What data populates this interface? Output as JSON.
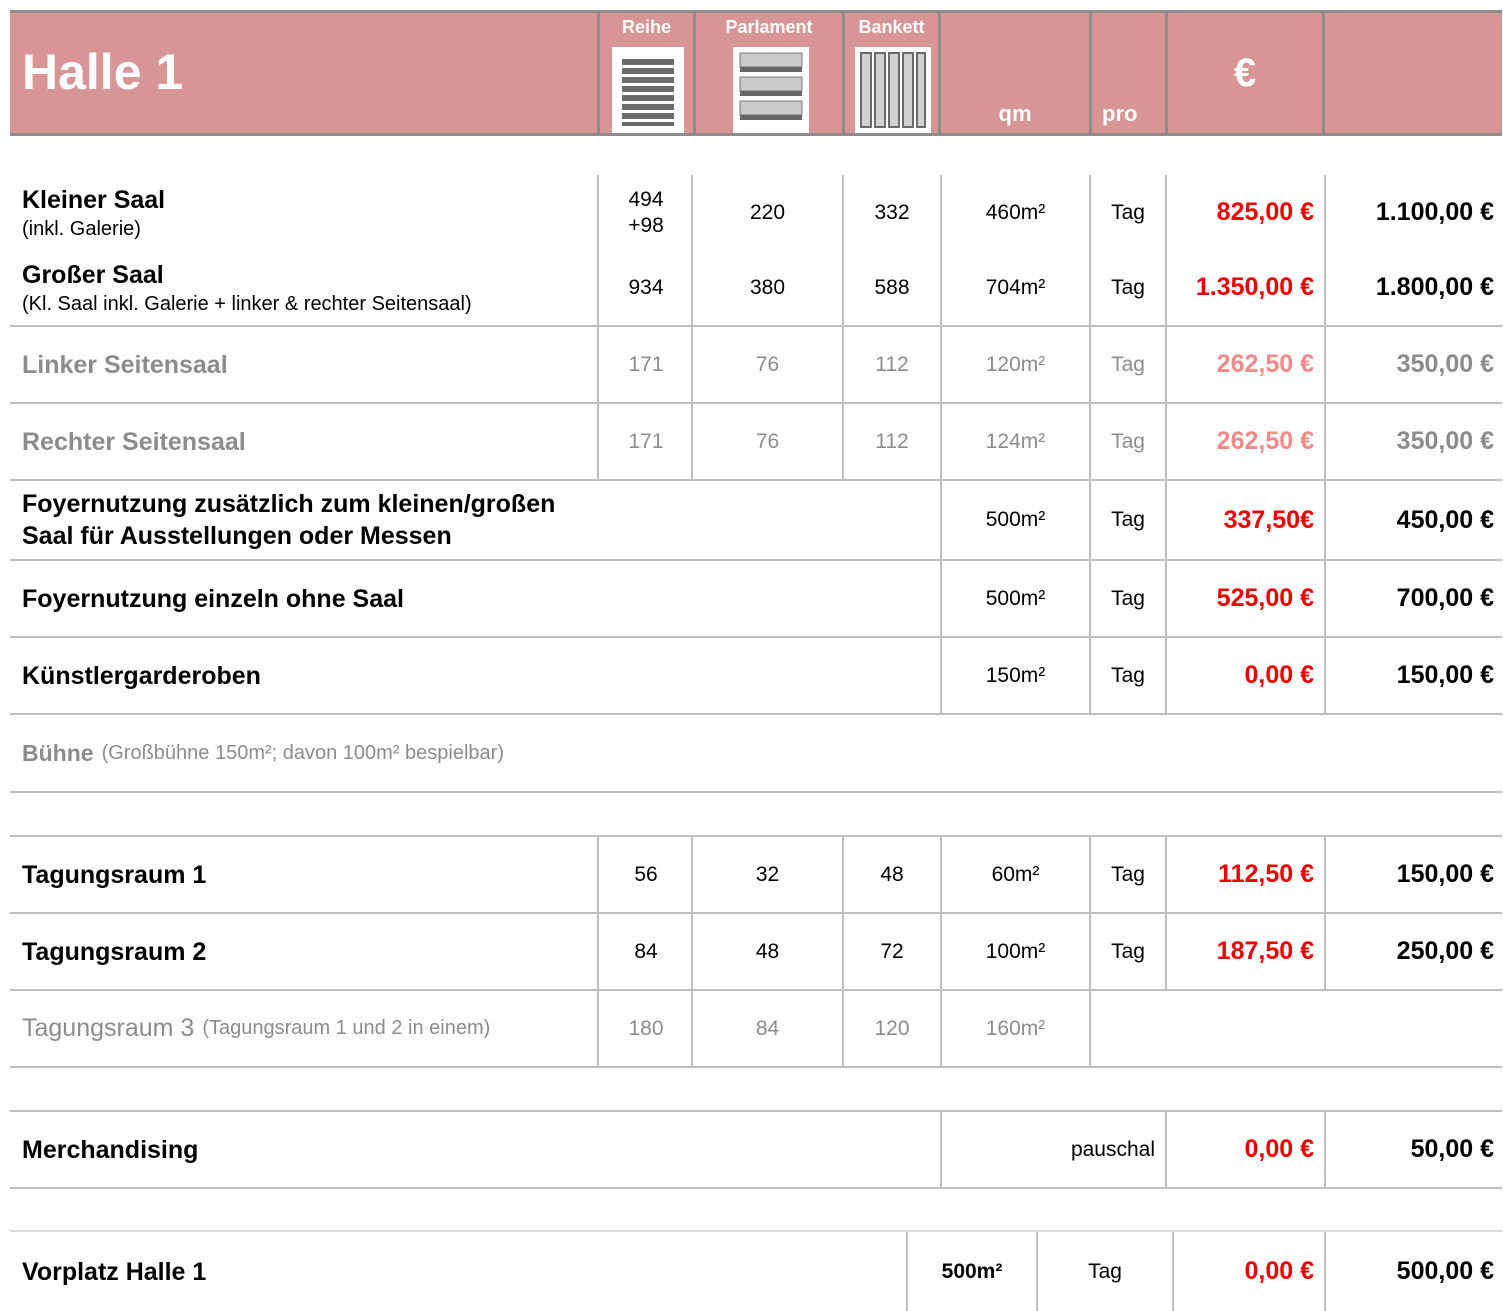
{
  "header": {
    "title": "Halle 1",
    "col_reihe": "Reihe",
    "col_parlament": "Parlament",
    "col_bankett": "Bankett",
    "col_qm": "qm",
    "col_pro": "pro",
    "col_euro": "€"
  },
  "rows": [
    {
      "name": "Kleiner Saal",
      "sub": "(inkl. Galerie)",
      "reihe": "494\n+98",
      "parlament": "220",
      "bankett": "332",
      "qm": "460m²",
      "pro": "Tag",
      "price_red": "825,00 €",
      "price": "1.100,00 €"
    },
    {
      "name": "Großer Saal",
      "sub": "(Kl. Saal inkl. Galerie + linker & rechter Seitensaal)",
      "reihe": "934",
      "parlament": "380",
      "bankett": "588",
      "qm": "704m²",
      "pro": "Tag",
      "price_red": "1.350,00 €",
      "price": "1.800,00 €"
    },
    {
      "name": "Linker Seitensaal",
      "reihe": "171",
      "parlament": "76",
      "bankett": "112",
      "qm": "120m²",
      "pro": "Tag",
      "price_red": "262,50 €",
      "price": "350,00 €"
    },
    {
      "name": "Rechter Seitensaal",
      "reihe": "171",
      "parlament": "76",
      "bankett": "112",
      "qm": "124m²",
      "pro": "Tag",
      "price_red": "262,50 €",
      "price": "350,00 €"
    },
    {
      "name_line1": "Foyernutzung zusätzlich zum kleinen/großen",
      "name_line2": "Saal für Ausstellungen oder Messen",
      "qm": "500m²",
      "pro": "Tag",
      "price_red": "337,50€",
      "price": "450,00 €"
    },
    {
      "name": "Foyernutzung einzeln ohne Saal",
      "qm": "500m²",
      "pro": "Tag",
      "price_red": "525,00 €",
      "price": "700,00 €"
    },
    {
      "name": "Künstlergarderoben",
      "qm": "150m²",
      "pro": "Tag",
      "price_red": "0,00 €",
      "price": "150,00 €"
    }
  ],
  "buehne": {
    "label": "Bühne",
    "note": "(Großbühne 150m²; davon 100m² bespielbar)"
  },
  "tagung": [
    {
      "name": "Tagungsraum 1",
      "reihe": "56",
      "parlament": "32",
      "bankett": "48",
      "qm": "60m²",
      "pro": "Tag",
      "price_red": "112,50 €",
      "price": "150,00 €"
    },
    {
      "name": "Tagungsraum 2",
      "reihe": "84",
      "parlament": "48",
      "bankett": "72",
      "qm": "100m²",
      "pro": "Tag",
      "price_red": "187,50 €",
      "price": "250,00 €"
    },
    {
      "name": "Tagungsraum 3",
      "note": "(Tagungsraum 1 und 2 in einem)",
      "reihe": "180",
      "parlament": "84",
      "bankett": "120",
      "qm": "160m²"
    }
  ],
  "merch": {
    "name": "Merchandising",
    "pro": "pauschal",
    "price_red": "0,00 €",
    "price": "50,00 €"
  },
  "vorplatz": {
    "name": "Vorplatz Halle 1",
    "qm": "500m²",
    "pro": "Tag",
    "price_red": "0,00 €",
    "price": "500,00 €"
  }
}
